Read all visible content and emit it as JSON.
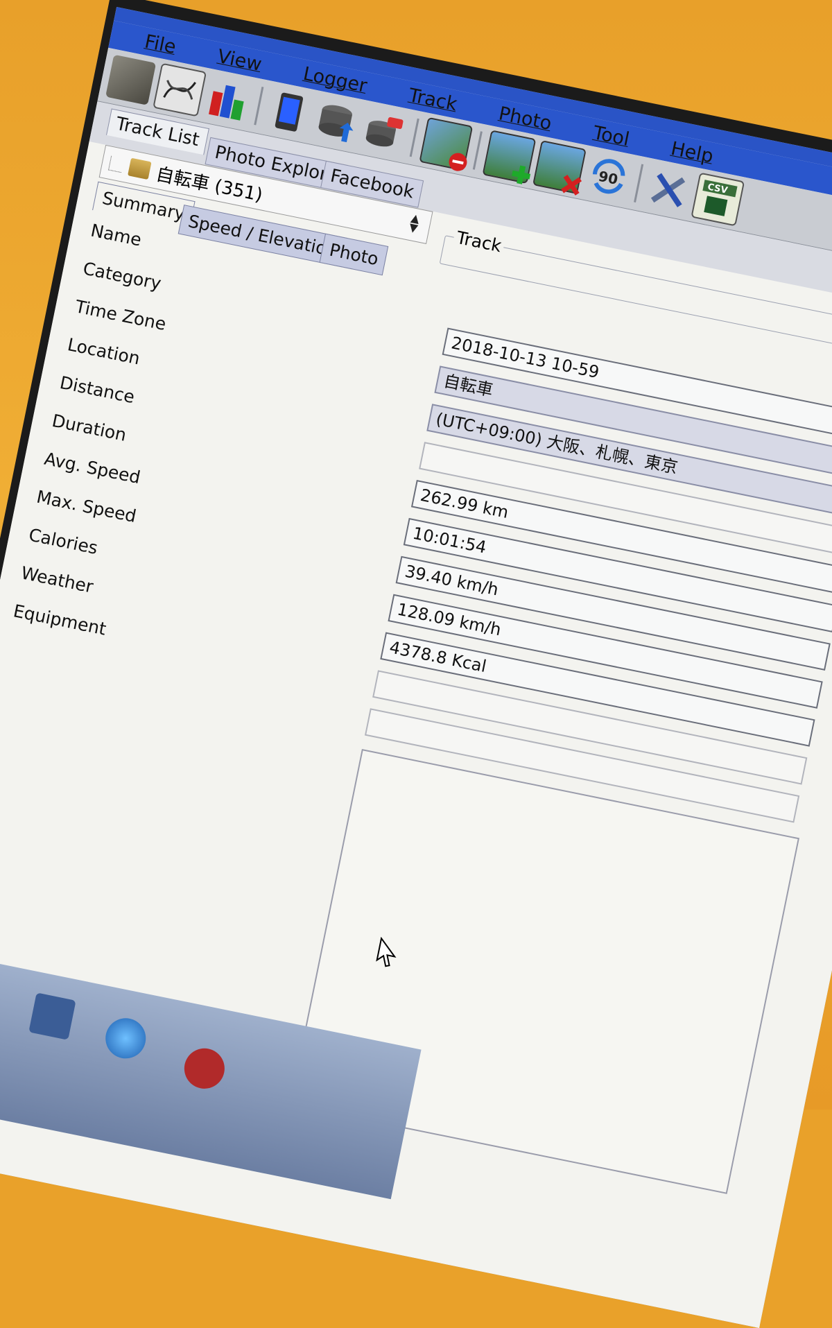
{
  "menu": [
    "File",
    "View",
    "Logger",
    "Track",
    "Photo",
    "Tool",
    "Help"
  ],
  "toolbar_icons": [
    "photo-icon",
    "chart-icon",
    "bar-chart-icon",
    "device-icon",
    "database-upload-icon",
    "database-erase-icon",
    "map-remove-icon",
    "add-photo-icon",
    "remove-photo-icon",
    "rotate-90-icon",
    "tools-icon",
    "csv-export-icon"
  ],
  "toolbar_rotate_label": "90",
  "toolbar_csv_label": "CSV",
  "main_tabs": [
    "Track List",
    "Photo Explore",
    "Facebook"
  ],
  "tree_item": "自転車 (351)",
  "sub_tabs": [
    "Summary",
    "Speed / Elevation",
    "Photo"
  ],
  "track_group_label": "Track",
  "summary_labels": [
    "Name",
    "Category",
    "Time Zone",
    "Location",
    "Distance",
    "Duration",
    "Avg. Speed",
    "Max. Speed",
    "Calories",
    "Weather",
    "Equipment"
  ],
  "summary_values": {
    "name": "2018-10-13 10-59",
    "category": "自転車",
    "time_zone": "(UTC+09:00) 大阪、札幌、東京",
    "location": "",
    "distance": "262.99 km",
    "duration": "10:01:54",
    "avg_speed": "39.40 km/h",
    "max_speed": "128.09 km/h",
    "calories": "4378.8 Kcal",
    "weather": "",
    "equipment": ""
  }
}
